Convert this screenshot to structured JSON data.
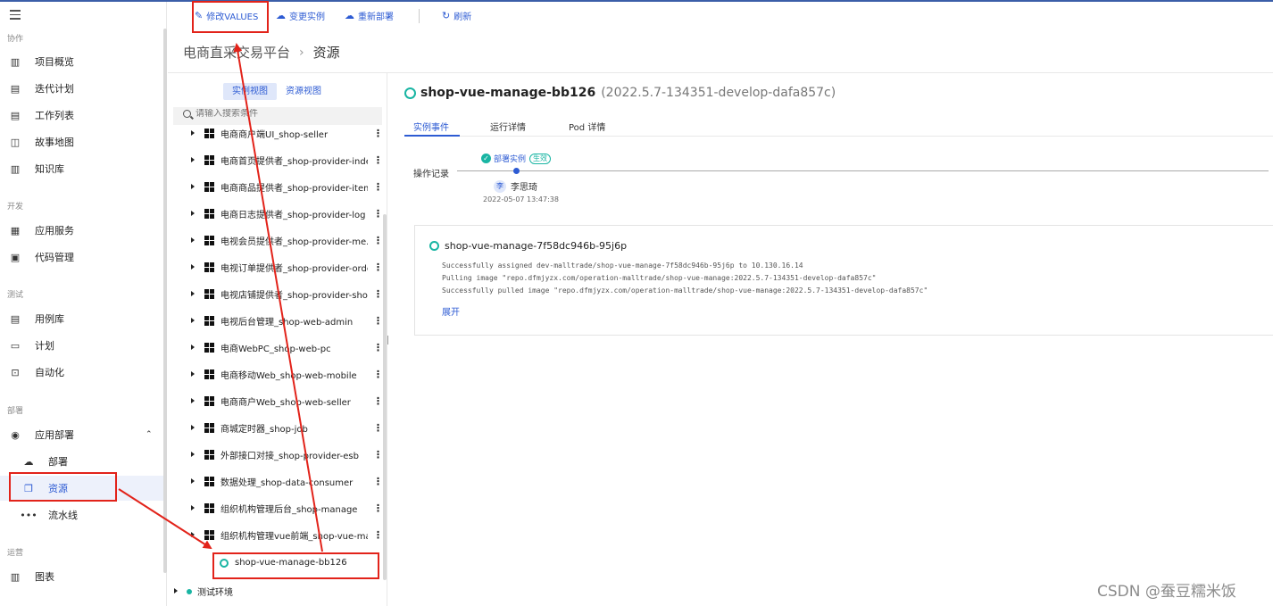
{
  "sidebar": {
    "sections": [
      {
        "label": "协作"
      },
      {
        "label": "开发"
      },
      {
        "label": "测试"
      },
      {
        "label": "部署"
      },
      {
        "label": "运营"
      }
    ],
    "items": [
      {
        "label": "项目概览",
        "icon": "bar-chart-icon"
      },
      {
        "label": "迭代计划",
        "icon": "clipboard-icon"
      },
      {
        "label": "工作列表",
        "icon": "list-icon"
      },
      {
        "label": "故事地图",
        "icon": "map-icon"
      },
      {
        "label": "知识库",
        "icon": "book-icon"
      },
      {
        "label": "应用服务",
        "icon": "apps-icon"
      },
      {
        "label": "代码管理",
        "icon": "code-icon"
      },
      {
        "label": "用例库",
        "icon": "document-icon"
      },
      {
        "label": "计划",
        "icon": "calendar-icon"
      },
      {
        "label": "自动化",
        "icon": "automation-icon"
      },
      {
        "label": "应用部署",
        "icon": "deploy-icon"
      },
      {
        "label": "部署",
        "icon": "cloud-upload-icon"
      },
      {
        "label": "资源",
        "icon": "resource-icon"
      },
      {
        "label": "流水线",
        "icon": "pipeline-icon"
      },
      {
        "label": "图表",
        "icon": "chart-icon"
      }
    ],
    "active_color": "#2d5bd3"
  },
  "toolbar": {
    "edit_values": "修改VALUES",
    "change_instance": "变更实例",
    "redeploy": "重新部署",
    "refresh": "刷新"
  },
  "breadcrumb": {
    "project": "电商直采交易平台",
    "separator": "›",
    "current": "资源"
  },
  "tree": {
    "view_tabs": [
      "实例视图",
      "资源视图"
    ],
    "search_placeholder": "请输入搜索条件",
    "apps": [
      "电商商户端UI_shop-seller",
      "电商首页提供者_shop-provider-index",
      "电商商品提供者_shop-provider-item",
      "电商日志提供者_shop-provider-log",
      "电视会员提供者_shop-provider-me...",
      "电视订单提供者_shop-provider-order",
      "电视店铺提供者_shop-provider-shop",
      "电视后台管理_shop-web-admin",
      "电商WebPC_shop-web-pc",
      "电商移动Web_shop-web-mobile",
      "电商商户Web_shop-web-seller",
      "商城定时器_shop-job",
      "外部接口对接_shop-provider-esb",
      "数据处理_shop-data-consumer",
      "组织机构管理后台_shop-manage",
      "组织机构管理vue前端_shop-vue-ma..."
    ],
    "selected_instance": "shop-vue-manage-bb126",
    "env": "测试环境"
  },
  "detail": {
    "name": "shop-vue-manage-bb126",
    "version": "(2022.5.7-134351-develop-dafa857c)",
    "tabs": [
      "实例事件",
      "运行详情",
      "Pod 详情"
    ],
    "op_label": "操作记录",
    "event": {
      "title": "部署实例",
      "tag": "生效",
      "user_avatar": "李",
      "user": "李思琦",
      "time": "2022-05-07 13:47:38"
    },
    "pod": {
      "name": "shop-vue-manage-7f58dc946b-95j6p",
      "logs": [
        "Successfully assigned dev-malltrade/shop-vue-manage-7f58dc946b-95j6p to 10.130.16.14",
        "Pulling image \"repo.dfmjyzx.com/operation-malltrade/shop-vue-manage:2022.5.7-134351-develop-dafa857c\"",
        "Successfully pulled image \"repo.dfmjyzx.com/operation-malltrade/shop-vue-manage:2022.5.7-134351-develop-dafa857c\""
      ],
      "expand": "展开"
    },
    "status_color": "#19b5a3"
  },
  "watermark": "CSDN @蚕豆糯米饭",
  "annotation_color": "#e2231a"
}
